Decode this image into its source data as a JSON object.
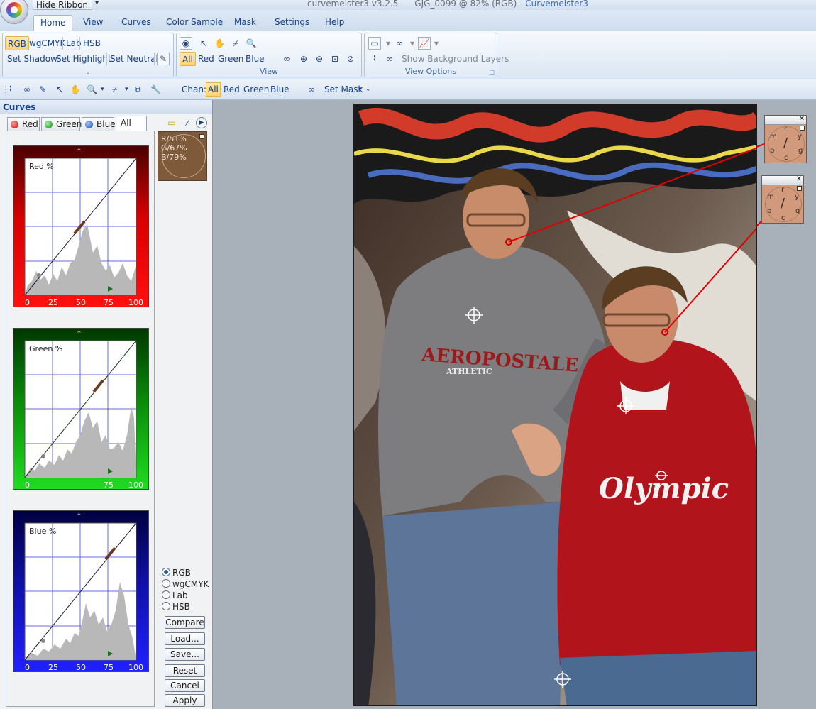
{
  "window": {
    "hide_ribbon": "Hide Ribbon",
    "title_prefix": "curvemeister3 v3.2.5",
    "document": "GJG_0099 @ 82% (RGB) -",
    "app_name": "Curvemeister3"
  },
  "tabs": [
    "Home",
    "View",
    "Curves",
    "Color Sample",
    "Mask",
    "Settings",
    "Help"
  ],
  "ribbon": {
    "group1": {
      "modes": [
        "RGB",
        "wgCMYK",
        "Lab",
        "HSB"
      ],
      "buttons": [
        "Set Shadow",
        "Set Highlight",
        "Set Neutral"
      ],
      "label": "."
    },
    "group2": {
      "channels": [
        "All",
        "Red",
        "Green",
        "Blue"
      ],
      "label": "View"
    },
    "group3": {
      "show_bg": "Show Background Layers",
      "label": "View Options"
    }
  },
  "toolbar": {
    "chan_label": "Chan:",
    "channels": [
      "All",
      "Red",
      "Green",
      "Blue"
    ],
    "set_mask": "Set Mask"
  },
  "panel": {
    "title": "Curves",
    "tabs": [
      "Red",
      "Green",
      "Blue",
      "All"
    ],
    "curves": [
      {
        "label": "Red %",
        "ticks": [
          "0",
          "25",
          "50",
          "75",
          "100"
        ]
      },
      {
        "label": "Green %",
        "ticks": [
          "0",
          "",
          "",
          "75",
          "100"
        ]
      },
      {
        "label": "Blue %",
        "ticks": [
          "0",
          "25",
          "50",
          "75",
          "100"
        ]
      }
    ],
    "sample": {
      "r": "R/51%",
      "g": "G/67%",
      "b": "B/79%"
    },
    "color_modes": [
      "RGB",
      "wgCMYK",
      "Lab",
      "HSB"
    ],
    "selected_mode": "RGB",
    "buttons": [
      "Compare",
      "Load...",
      "Save...",
      "Reset",
      "Cancel",
      "Apply"
    ]
  },
  "probes": [
    {
      "letters": [
        "r",
        "y",
        "g",
        "c",
        "b",
        "m"
      ]
    },
    {
      "letters": [
        "r",
        "y",
        "g",
        "c",
        "b",
        "m"
      ]
    }
  ],
  "photo": {
    "sweatshirt1": "AEROPOSTALE",
    "sweatshirt1b": "ATHLETIC",
    "sweatshirt2": "Olympic"
  },
  "colors": {
    "accent_selected": "#ffd36b",
    "ribbon_text": "#15428b",
    "red_box": "#b00000",
    "green_box": "#0a8a0a",
    "blue_box": "#1010a8"
  }
}
